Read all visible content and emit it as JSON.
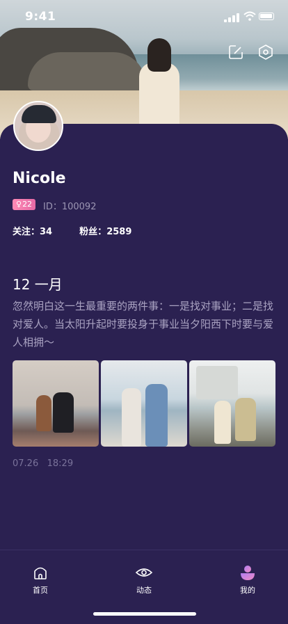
{
  "status_bar": {
    "time": "9:41"
  },
  "header": {
    "icons": [
      "edit-icon",
      "settings-icon"
    ]
  },
  "profile": {
    "name": "Nicole",
    "gender_symbol": "♀",
    "age": "22",
    "user_id": "ID：100092",
    "following_label": "关注：",
    "following_count": "34",
    "followers_label": "粉丝：",
    "followers_count": "2589"
  },
  "post": {
    "date_title": "12 一月",
    "text": "忽然明白这一生最重要的两件事：一是找对事业；二是找对爱人。当太阳升起时要投身于事业当夕阳西下时要与爱人相拥～",
    "time_date": "07.26",
    "time_clock": "18:29",
    "photos": [
      "photo-couple-sunset",
      "photo-couple-beach",
      "photo-couple-castle"
    ]
  },
  "tabbar": {
    "tabs": [
      {
        "label": "首页",
        "icon": "home-icon",
        "active": false
      },
      {
        "label": "动态",
        "icon": "eye-icon",
        "active": false
      },
      {
        "label": "我的",
        "icon": "profile-icon",
        "active": true
      }
    ]
  },
  "colors": {
    "background": "#2b2151",
    "muted_text": "#aaa3c2",
    "badge": "#ff8ab5",
    "accent": "#c58af5"
  }
}
